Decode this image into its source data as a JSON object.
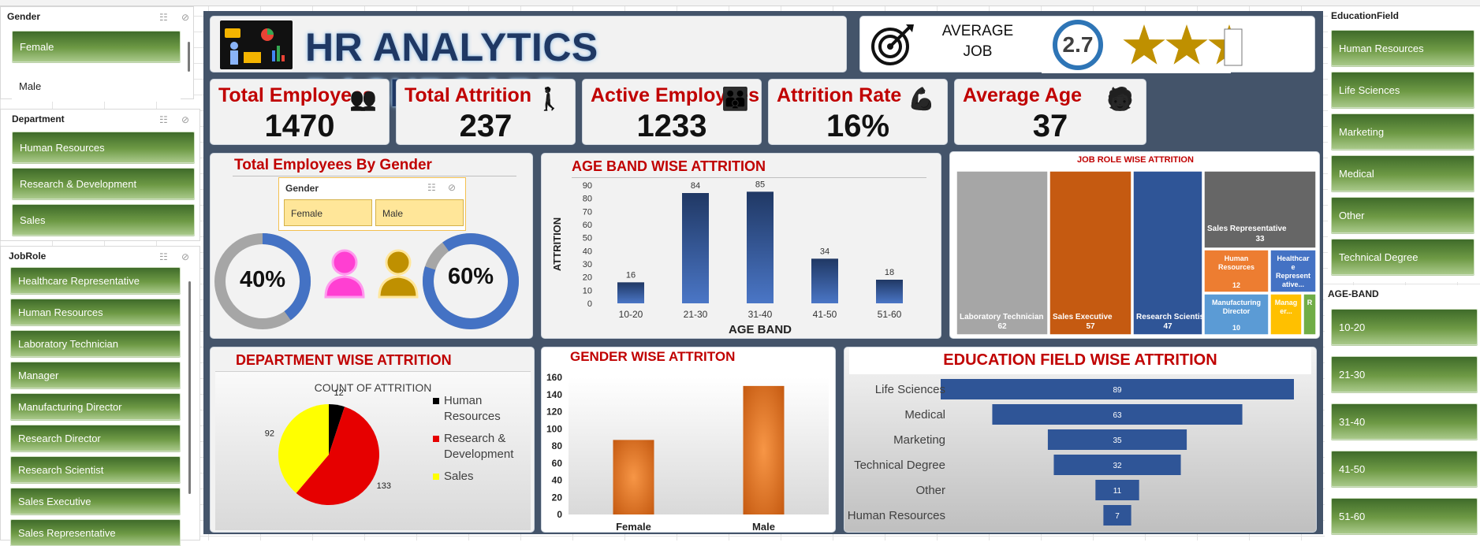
{
  "slicers": {
    "gender": {
      "title": "Gender",
      "items": [
        "Female",
        "Male"
      ]
    },
    "department": {
      "title": "Department",
      "items": [
        "Human Resources",
        "Research & Development",
        "Sales"
      ]
    },
    "jobrole": {
      "title": "JobRole",
      "items": [
        "Healthcare Representative",
        "Human Resources",
        "Laboratory Technician",
        "Manager",
        "Manufacturing Director",
        "Research Director",
        "Research Scientist",
        "Sales Executive",
        "Sales Representative"
      ]
    },
    "education": {
      "title": "EducationField",
      "items": [
        "Human Resources",
        "Life Sciences",
        "Marketing",
        "Medical",
        "Other",
        "Technical Degree"
      ]
    },
    "ageband": {
      "title": "AGE-BAND",
      "items": [
        "10-20",
        "21-30",
        "31-40",
        "41-50",
        "51-60"
      ]
    }
  },
  "header": {
    "title": "HR ANALYTICS DASHBOARD"
  },
  "rating": {
    "label_line1": "AVERAGE",
    "label_line2": "JOB",
    "value": "2.7",
    "stars_filled": 2.7,
    "stars_total": 4
  },
  "kpis": [
    {
      "title": "Total Employees",
      "value": "1470",
      "icon": "people-icon"
    },
    {
      "title": "Total Attrition",
      "value": "237",
      "icon": "person-leaving-icon"
    },
    {
      "title": "Active Employees",
      "value": "1233",
      "icon": "group-icon"
    },
    {
      "title": "Attrition  Rate",
      "value": "16%",
      "icon": "flexed-arm-icon"
    },
    {
      "title": "Average Age",
      "value": "37",
      "icon": "elderly-person-icon"
    }
  ],
  "gender_panel": {
    "title": "Total Employees By Gender",
    "slicer_title": "Gender",
    "slicer_items": [
      "Female",
      "Male"
    ],
    "female_pct": "40%",
    "male_pct": "60%"
  },
  "chart_age": {
    "title": "AGE BAND WISE ATTRITION",
    "chart_data": {
      "type": "bar",
      "categories": [
        "10-20",
        "21-30",
        "31-40",
        "41-50",
        "51-60"
      ],
      "values": [
        16,
        84,
        85,
        34,
        18
      ],
      "xlabel": "AGE BAND",
      "ylabel": "ATTRITION",
      "ylim": [
        0,
        90
      ],
      "yticks": [
        0,
        10,
        20,
        30,
        40,
        50,
        60,
        70,
        80,
        90
      ],
      "color": "#2f5597"
    }
  },
  "chart_jobrole": {
    "title": "JOB ROLE WISE ATTRITION",
    "chart_data": {
      "type": "treemap",
      "labels": [
        "Laboratory Technician",
        "Sales Executive",
        "Research Scientist",
        "Sales Representative",
        "Human Resources",
        "Healthcare Representative",
        "Manufacturing Director",
        "Manager",
        "Research Director"
      ],
      "values": [
        62,
        57,
        47,
        33,
        12,
        9,
        10,
        5,
        2
      ],
      "colors": [
        "#a6a6a6",
        "#c55a11",
        "#2f5597",
        "#666666",
        "#ed7d31",
        "#4472c4",
        "#5b9bd5",
        "#ffc000",
        "#70ad47"
      ]
    },
    "display_labels": [
      "Laboratory Technician",
      "Sales Executive",
      "Research Scientist",
      "Sales Representative",
      "Human Resources",
      "Healthcar e Represent ative...",
      "Manufacturing Director",
      "Manag er...",
      "R"
    ],
    "display_values": [
      "62",
      "57",
      "47",
      "33",
      "12",
      "",
      "10",
      "",
      ""
    ]
  },
  "chart_dept": {
    "title": "DEPARTMENT WISE ATTRITION",
    "chart_data": {
      "type": "pie",
      "title": "COUNT OF ATTRITION",
      "labels": [
        "Human Resources",
        "Research & Development",
        "Sales"
      ],
      "values": [
        12,
        133,
        92
      ],
      "colors": [
        "#000000",
        "#e60000",
        "#ffff00"
      ],
      "legend": "right"
    },
    "legend_lines": [
      [
        "Human",
        "Resources"
      ],
      [
        "Research &",
        "Development"
      ],
      [
        "Sales"
      ]
    ]
  },
  "chart_gender": {
    "title": "GENDER WISE ATTRITON",
    "chart_data": {
      "type": "bar",
      "categories": [
        "Female",
        "Male"
      ],
      "values": [
        87,
        150
      ],
      "ylim": [
        0,
        160
      ],
      "yticks": [
        0,
        20,
        40,
        60,
        80,
        100,
        120,
        140,
        160
      ],
      "color": "#e36c0a"
    }
  },
  "chart_edu": {
    "title": "EDUCATION FIELD WISE ATTRITION",
    "chart_data": {
      "type": "bar",
      "orientation": "funnel",
      "categories": [
        "Life Sciences",
        "Medical",
        "Marketing",
        "Technical Degree",
        "Other",
        "Human Resources"
      ],
      "values": [
        89,
        63,
        35,
        32,
        11,
        7
      ],
      "color": "#2f5597"
    }
  }
}
